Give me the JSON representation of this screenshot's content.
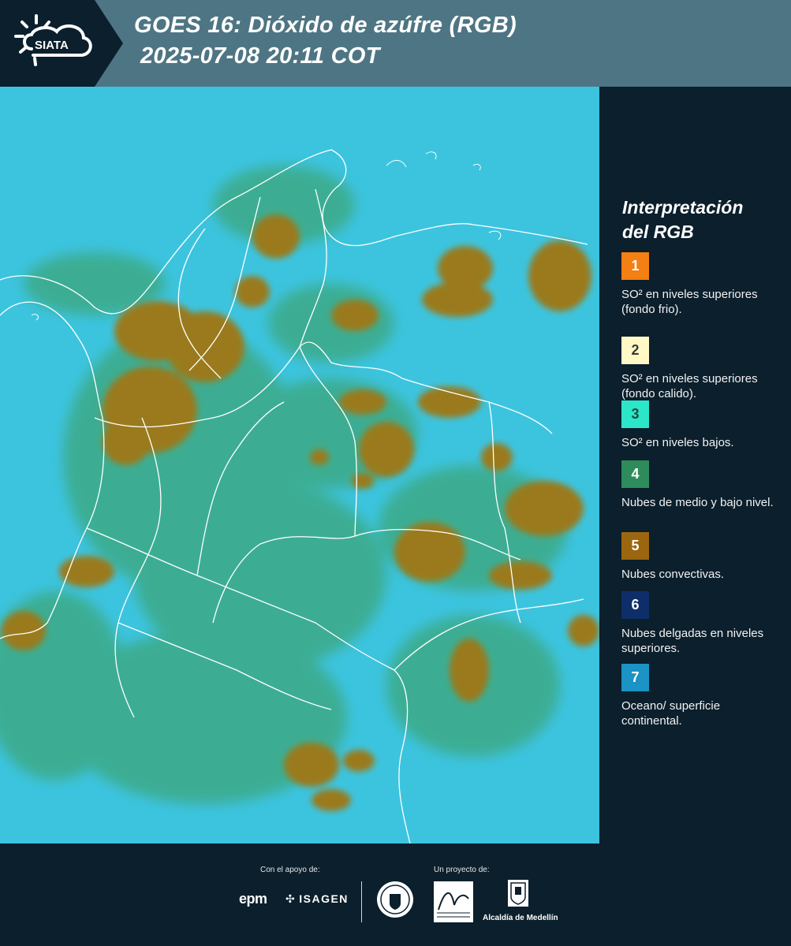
{
  "header": {
    "logo_text": "SIATA",
    "title_line1": "GOES 16: Dióxido de azúfre (RGB)",
    "title_line2": "2025-07-08 20:11 COT"
  },
  "colors": {
    "header_dark": "#0b1f2c",
    "header_band": "#4e7583",
    "surface": "#3cc4df",
    "low_clouds": "#3f9a4e",
    "convective": "#9a7a1f",
    "border_lines": "#ffffff"
  },
  "legend": {
    "title_line1": "Interpretación",
    "title_line2": "del RGB",
    "items": [
      {
        "number": "1",
        "label": "SO² en niveles superiores (fondo frio).",
        "color": "#f47f12",
        "text_color": "#ffffff"
      },
      {
        "number": "2",
        "label": "SO² en niveles superiores (fondo calido).",
        "color": "#fff9c6",
        "text_color": "#3a3a3a"
      },
      {
        "number": "3",
        "label": "SO² en niveles bajos.",
        "color": "#2be6c8",
        "text_color": "#1d4a44"
      },
      {
        "number": "4",
        "label": "Nubes de medio y bajo nivel.",
        "color": "#2e8c5c",
        "text_color": "#ffffff"
      },
      {
        "number": "5",
        "label": "Nubes convectivas.",
        "color": "#9c6610",
        "text_color": "#ffffff"
      },
      {
        "number": "6",
        "label": "Nubes delgadas en niveles superiores.",
        "color": "#0e2e6a",
        "text_color": "#ffffff"
      },
      {
        "number": "7",
        "label": "Oceano/ superficie continental.",
        "color": "#1b93c4",
        "text_color": "#ffffff"
      }
    ]
  },
  "footer": {
    "support_label": "Con el apoyo de:",
    "project_label": "Un proyecto de:",
    "sponsors": [
      "epm",
      "ISAGEN"
    ],
    "partners": [
      "Alcaldía de Medellín"
    ]
  }
}
